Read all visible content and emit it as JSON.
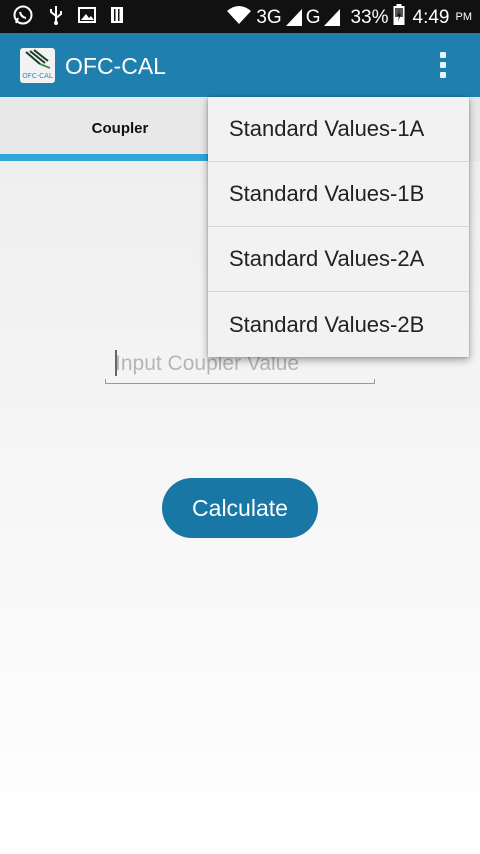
{
  "status_bar": {
    "network_3g": "3G",
    "network_g": "G",
    "battery": "33%",
    "time": "4:49",
    "ampm": "PM",
    "icons": [
      "whatsapp-icon",
      "usb-icon",
      "gallery-icon",
      "sim-icon",
      "wifi-icon",
      "signal-icon",
      "battery-icon"
    ]
  },
  "app_bar": {
    "title": "OFC-CAL",
    "logo_text": "OFC-CAL",
    "background": "#1f80b0"
  },
  "tabs": [
    {
      "label": "Coupler",
      "selected": true
    }
  ],
  "input": {
    "placeholder": "Input Coupler Value",
    "value": ""
  },
  "button": {
    "label": "Calculate",
    "color": "#1877a4"
  },
  "menu": {
    "items": [
      {
        "label": "Standard Values-1A"
      },
      {
        "label": "Standard Values-1B"
      },
      {
        "label": "Standard Values-2A"
      },
      {
        "label": "Standard Values-2B"
      }
    ]
  },
  "accent_color": "#30a6db"
}
